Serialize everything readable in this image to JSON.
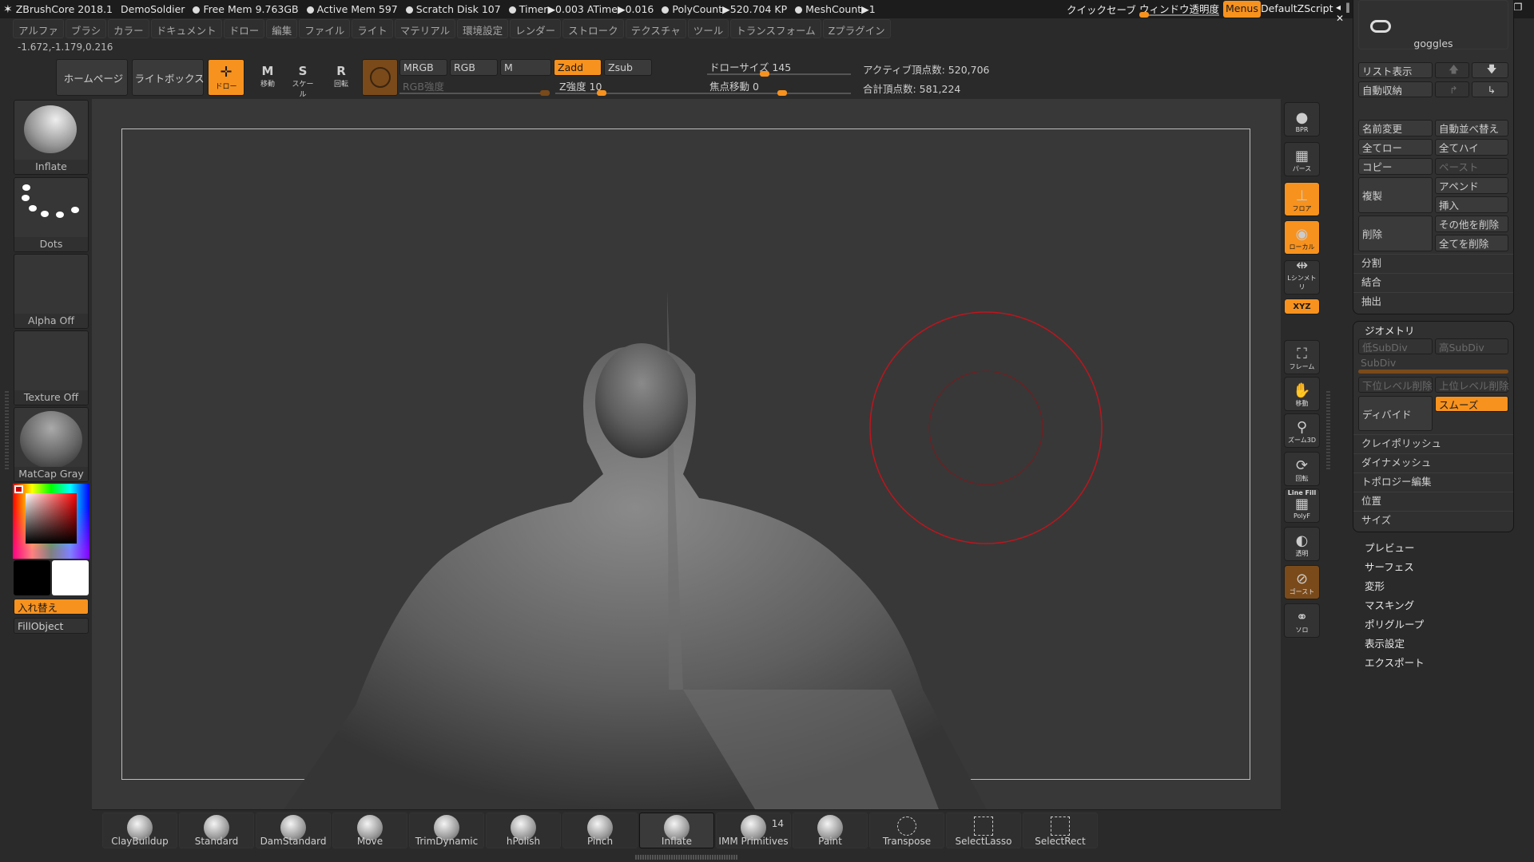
{
  "titlebar": {
    "app": "ZBrushCore 2018.1",
    "project": "DemoSoldier",
    "free_mem": "Free Mem 9.763GB",
    "active_mem": "Active Mem 597",
    "scratch": "Scratch Disk 107",
    "timer": "Timer▶0.003 ATime▶0.016",
    "polycount": "PolyCount▶520.704 KP",
    "meshcount": "MeshCount▶1",
    "quicksave": "クイックセーブ",
    "transparency": "ウィンドウ透明度",
    "menus": "Menus",
    "zscript": "DefaultZScript"
  },
  "menus": [
    "アルファ",
    "ブラシ",
    "カラー",
    "ドキュメント",
    "ドロー",
    "編集",
    "ファイル",
    "ライト",
    "マテリアル",
    "環境設定",
    "レンダー",
    "ストローク",
    "テクスチャ",
    "ツール",
    "トランスフォーム",
    "Zプラグイン"
  ],
  "coords": "-1.672,-1.179,0.216",
  "toolbar": {
    "home": "ホームページ",
    "lightbox": "ライトボックス",
    "draw": "ドロー",
    "move": "移動",
    "scale": "スケール",
    "rotate": "回転",
    "mrgb": "MRGB",
    "rgb": "RGB",
    "m": "M",
    "zadd": "Zadd",
    "zsub": "Zsub",
    "rgb_intensity": "RGB強度",
    "z_intensity": "Z強度 10",
    "draw_size": "ドローサイズ 145",
    "focal_shift": "焦点移動 0",
    "active_points": "アクティブ頂点数: 520,706",
    "total_points": "合計頂点数: 581,224",
    "draw_size_value": 145,
    "z_intensity_value": 10,
    "focal_shift_value": 0
  },
  "left": {
    "brush": "Inflate",
    "stroke": "Dots",
    "alpha": "Alpha Off",
    "texture": "Texture Off",
    "material": "MatCap Gray",
    "swap": "入れ替え",
    "fill": "FillObject",
    "main_color": "#000000",
    "secondary_color": "#ffffff"
  },
  "right_icons": [
    {
      "label": "BPR",
      "icon": "bpr-icon"
    },
    {
      "label": "パース",
      "icon": "perspective-icon"
    },
    {
      "label": "フロア",
      "icon": "floor-icon",
      "active": true
    },
    {
      "label": "ローカル",
      "icon": "local-icon",
      "active": true
    },
    {
      "label": "Lシンメトリ",
      "icon": "symmetry-icon"
    },
    {
      "label": "XYZ",
      "icon": "xyz-rotate-icon",
      "active": true
    },
    {
      "label": "フレーム",
      "icon": "frame-icon"
    },
    {
      "label": "移動",
      "icon": "move-hand-icon"
    },
    {
      "label": "ズーム3D",
      "icon": "zoom3d-icon"
    },
    {
      "label": "回転",
      "icon": "rotate-icon"
    },
    {
      "label": "PolyF",
      "icon": "polyframe-icon",
      "top": "Line Fill"
    },
    {
      "label": "透明",
      "icon": "transparent-icon"
    },
    {
      "label": "ゴースト",
      "icon": "ghost-icon"
    },
    {
      "label": "ソロ",
      "icon": "solo-icon"
    }
  ],
  "subtool": {
    "name": "goggles",
    "list": "リスト表示",
    "autocollapse": "自動収納",
    "rename": "名前変更",
    "autoreorder": "自動並べ替え",
    "all_low": "全てロー",
    "all_high": "全てハイ",
    "copy": "コピー",
    "paste": "ペースト",
    "duplicate": "複製",
    "append": "アペンド",
    "insert": "挿入",
    "delete": "削除",
    "del_other": "その他を削除",
    "del_all": "全てを削除",
    "split": "分割",
    "merge": "結合",
    "extract": "抽出"
  },
  "geometry": {
    "title": "ジオメトリ",
    "lower": "低SubDiv",
    "higher": "高SubDiv",
    "subdiv": "SubDiv",
    "del_lower": "下位レベル削除",
    "del_higher": "上位レベル削除",
    "divide": "ディバイド",
    "smooth": "スムーズ",
    "items": [
      "クレイポリッシュ",
      "ダイナメッシュ",
      "トポロジー編集",
      "位置",
      "サイズ"
    ]
  },
  "tool_sections": [
    "プレビュー",
    "サーフェス",
    "変形",
    "マスキング",
    "ポリグループ",
    "表示設定",
    "エクスポート"
  ],
  "brushes": [
    "ClayBuildup",
    "Standard",
    "DamStandard",
    "Move",
    "TrimDynamic",
    "hPolish",
    "Pinch",
    "Inflate",
    "IMM Primitives",
    "Paint",
    "Transpose",
    "SelectLasso",
    "SelectRect"
  ],
  "imm_count": "14",
  "colors": {
    "accent": "#f7921e",
    "brush_cursor": "#c0141c"
  }
}
